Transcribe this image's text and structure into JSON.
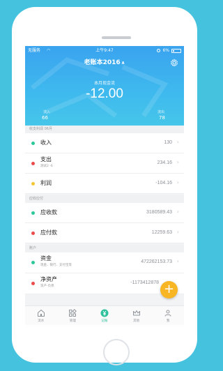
{
  "status": {
    "carrier": "无服务",
    "time": "上午9:47",
    "battery": "6%"
  },
  "header": {
    "title": "老账本2016",
    "flow_label": "本月现金流",
    "flow_value": "-12.00",
    "income_label": "流入",
    "income_value": "66",
    "outflow_label": "流出",
    "outflow_value": "78"
  },
  "sections": [
    {
      "title": "收支利润 06月",
      "rows": [
        {
          "label": "收入",
          "value": "130",
          "sub": "",
          "color": "#2dc89a"
        },
        {
          "label": "支出",
          "value": "234.16",
          "sub": "测试2 -6",
          "color": "#ec4b4b"
        },
        {
          "label": "利润",
          "value": "-104.16",
          "sub": "",
          "color": "#f4c634"
        }
      ]
    },
    {
      "title": "应收应付",
      "rows": [
        {
          "label": "应收款",
          "value": "3180589.43",
          "sub": "",
          "color": "#2dc89a"
        },
        {
          "label": "应付款",
          "value": "12259.63",
          "sub": "",
          "color": "#ec4b4b"
        }
      ]
    },
    {
      "title": "账户",
      "rows": [
        {
          "label": "资金",
          "value": "472262153.73",
          "sub": "现金、银行、支付宝等",
          "color": "#2dc89a"
        },
        {
          "label": "净资产",
          "value": "-1173412878",
          "sub": "资产-负债",
          "color": "#ec4b4b"
        }
      ]
    }
  ],
  "tabs": [
    {
      "label": "流水",
      "icon": "home-icon"
    },
    {
      "label": "管理",
      "icon": "grid-icon"
    },
    {
      "label": "记账",
      "icon": "yen-icon"
    },
    {
      "label": "其他",
      "icon": "crown-icon"
    },
    {
      "label": "我",
      "icon": "person-icon"
    }
  ],
  "active_tab": 2,
  "colors": {
    "accent": "#2fc19c",
    "header": "#3eb8ee",
    "fab": "#f8b624",
    "income": "#2dc89a",
    "expense": "#ec4b4b",
    "profit": "#f4c634"
  }
}
